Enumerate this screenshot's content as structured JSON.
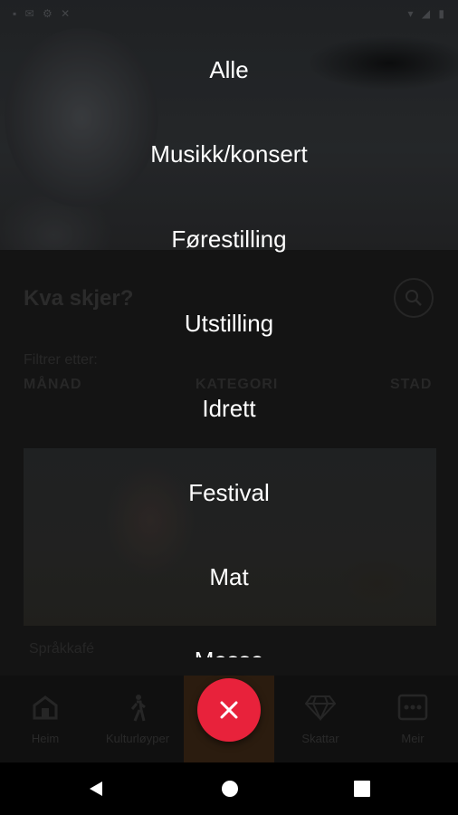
{
  "status_bar": {
    "left_icons": "▪ ✉ ⚙ ✕",
    "right_icons": "▾ ◢ ▮"
  },
  "page": {
    "title": "Kva skjer?",
    "filter_label": "Filtrer etter:",
    "filter_tabs": [
      "MÅNAD",
      "KATEGORI",
      "STAD"
    ],
    "card_title": "Språkkafé"
  },
  "bottom_nav": [
    {
      "label": "Heim",
      "icon": "home-icon"
    },
    {
      "label": "Kulturløyper",
      "icon": "walking-person-icon"
    },
    {
      "label": "",
      "icon": "",
      "active": true
    },
    {
      "label": "Skattar",
      "icon": "diamond-icon"
    },
    {
      "label": "Meir",
      "icon": "more-dots-icon"
    }
  ],
  "category_menu": {
    "items": [
      "Alle",
      "Musikk/konsert",
      "Førestilling",
      "Utstilling",
      "Idrett",
      "Festival",
      "Mat",
      "Messe"
    ],
    "close_icon": "close-icon",
    "close_color": "#e8223b"
  }
}
